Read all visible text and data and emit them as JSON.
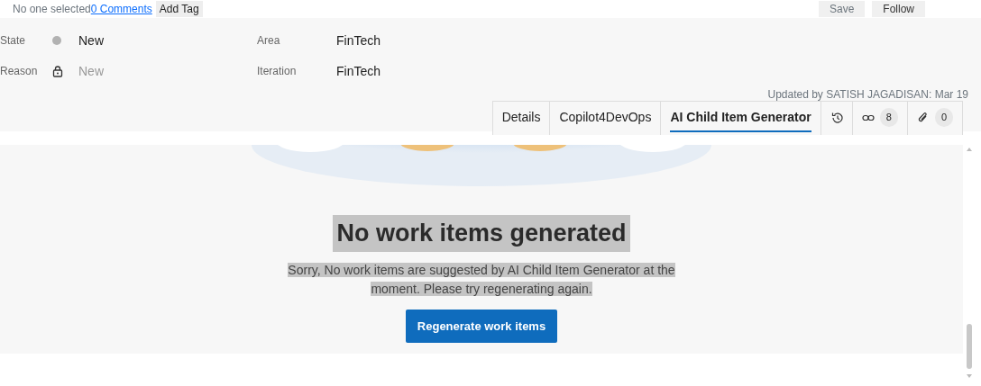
{
  "toolbar": {
    "assignee": "No one selected",
    "comments": "0 Comments",
    "add_tag": "Add Tag",
    "save": "Save",
    "follow": "Follow"
  },
  "fields_left": [
    {
      "label": "State",
      "value": "New",
      "kind": "dot",
      "color": "#b2b2b2",
      "disabled": false
    },
    {
      "label": "Reason",
      "value": "New",
      "kind": "lock",
      "disabled": true
    }
  ],
  "fields_right": [
    {
      "label": "Area",
      "value": "FinTech"
    },
    {
      "label": "Iteration",
      "value": "FinTech"
    }
  ],
  "updated": "Updated by SATISH JAGADISAN: Mar 19",
  "tabs": [
    {
      "label": "Details",
      "selected": false
    },
    {
      "label": "Copilot4DevOps",
      "selected": false
    },
    {
      "label": "AI Child Item Generator",
      "selected": true
    }
  ],
  "icon_tabs": [
    {
      "kind": "history"
    },
    {
      "kind": "links",
      "count": "8"
    },
    {
      "kind": "attachments",
      "count": "0"
    }
  ],
  "empty_state": {
    "title": "No work items generated",
    "message": "Sorry, No work items are suggested by AI Child Item Generator at the moment. Please try regenerating again.",
    "button": "Regenerate work items"
  }
}
